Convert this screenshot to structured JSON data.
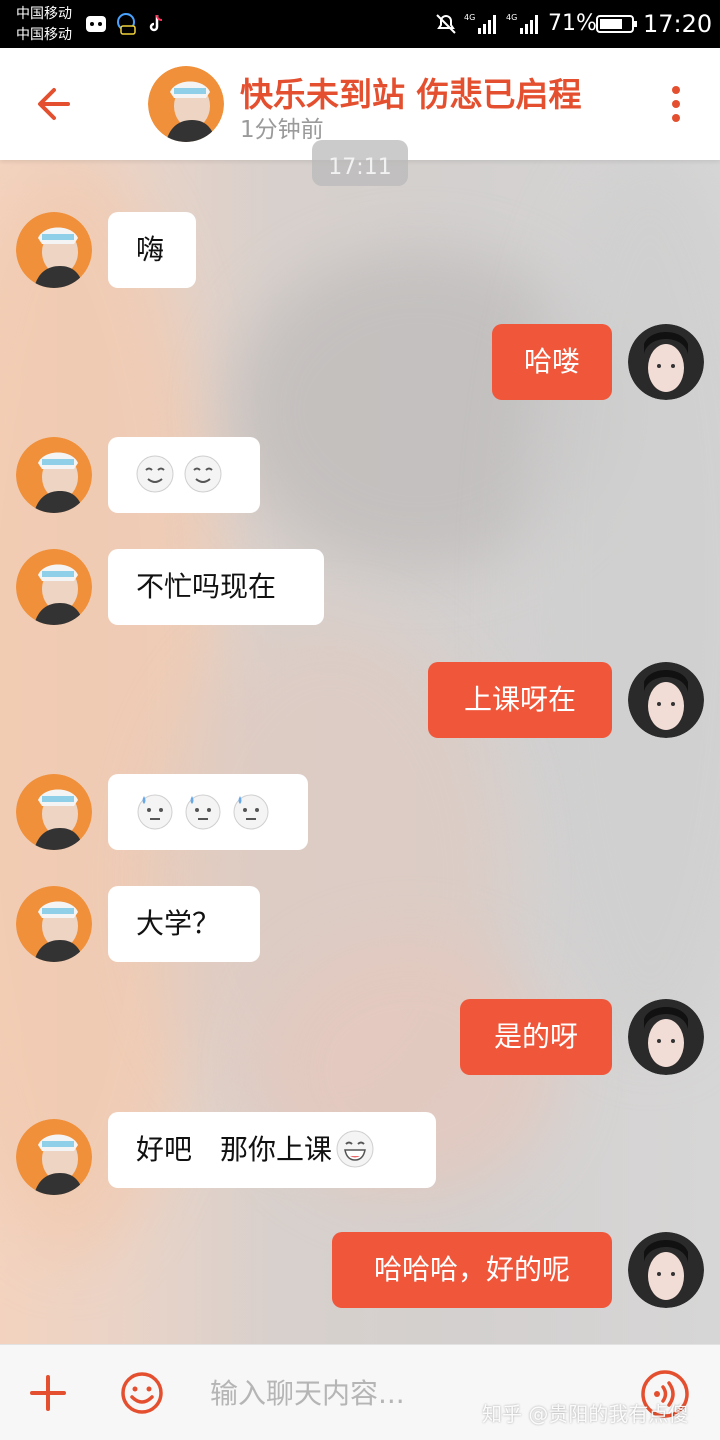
{
  "status_bar": {
    "carrier_1": "中国移动",
    "carrier_2": "中国移动",
    "battery_percent": "71%",
    "time": "17:20"
  },
  "header": {
    "contact_name": "快乐未到站 伤悲已启程",
    "contact_status": "1分钟前",
    "accent_color": "#e4502f"
  },
  "timestamp": "17:11",
  "messages": [
    {
      "side": "in",
      "text": "嗨"
    },
    {
      "side": "out",
      "text": "哈喽"
    },
    {
      "side": "in",
      "text": "",
      "emojis": [
        "smile-emoji",
        "smile-emoji"
      ]
    },
    {
      "side": "in",
      "text": "不忙吗现在"
    },
    {
      "side": "out",
      "text": "上课呀在"
    },
    {
      "side": "in",
      "text": "",
      "emojis": [
        "sweat-emoji",
        "sweat-emoji",
        "sweat-emoji"
      ]
    },
    {
      "side": "in",
      "text": "大学？"
    },
    {
      "side": "out",
      "text": "是的呀"
    },
    {
      "side": "in",
      "text": "好吧　那你上课",
      "emojis": [
        "grin-emoji"
      ]
    },
    {
      "side": "out",
      "text": "哈哈哈，好的呢"
    }
  ],
  "input_bar": {
    "placeholder": "输入聊天内容...",
    "icons": [
      "plus-icon",
      "emoji-icon",
      "voice-icon"
    ]
  },
  "watermark": "知乎 @贵阳的我有点傻",
  "colors": {
    "outgoing_bubble": "#f0563a",
    "incoming_bubble": "#ffffff"
  }
}
